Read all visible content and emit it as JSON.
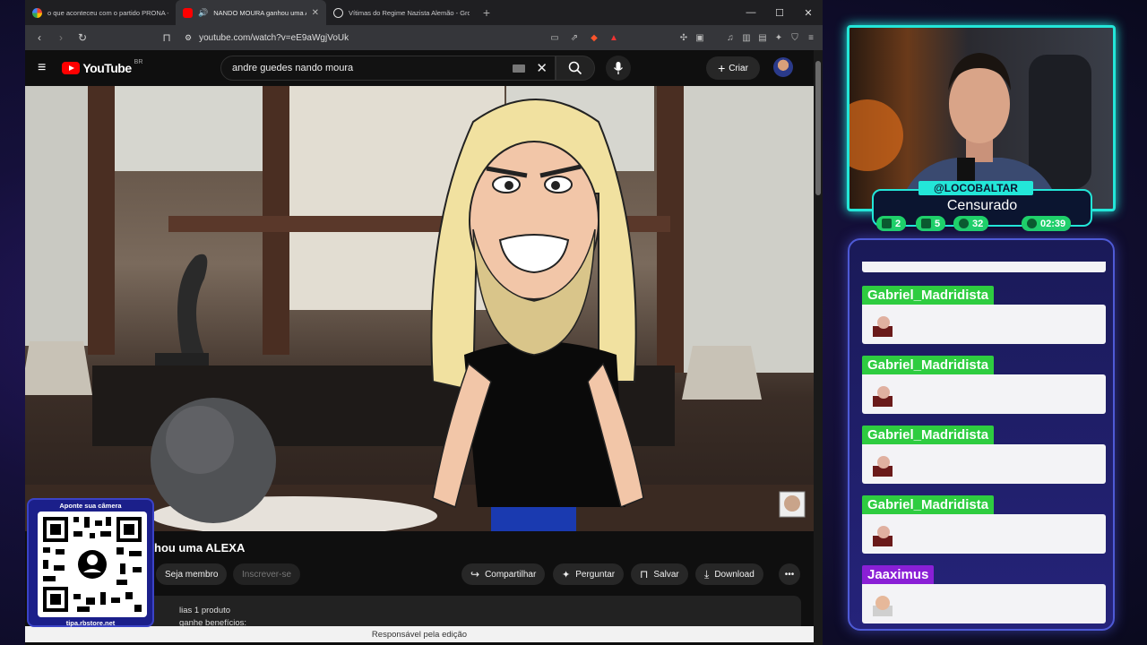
{
  "browser": {
    "tabs": [
      {
        "title": "o que aconteceu com o partido PRONA - Pe",
        "favicon_color": "#ffffff",
        "active": false
      },
      {
        "title": "NANDO MOURA ganhou uma ALEXA",
        "favicon_color": "#ff0000",
        "active": true
      },
      {
        "title": "Vítimas do Regime Nazista Alemão - Grok",
        "favicon_color": "#dddddd",
        "active": false
      }
    ],
    "url": "youtube.com/watch?v=eE9aWgjVoUk"
  },
  "youtube": {
    "logo_text": "YouTube",
    "country_code": "BR",
    "search_query": "andre guedes nando moura",
    "create_label": "Criar",
    "video_title": "hou uma ALEXA",
    "actions": {
      "member": "Seja membro",
      "subscribe": "Inscrever-se",
      "share": "Compartilhar",
      "ask": "Perguntar",
      "save": "Salvar",
      "download": "Download"
    },
    "description_line1": "lias  1 produto",
    "description_line2": "ganhe benefícios:"
  },
  "status_bar": "Responsável pela edição",
  "qr": {
    "top_label": "Aponte sua câmera",
    "bottom_label": "tipa.rbstore.net"
  },
  "stream": {
    "handle": "@LOCOBALTAR",
    "status": "Censurado",
    "stats": [
      {
        "icon": "chat-icon",
        "value": "2"
      },
      {
        "icon": "youtube-icon",
        "value": "5"
      },
      {
        "icon": "viewers-icon",
        "value": "32"
      },
      {
        "icon": "clock-icon",
        "value": "02:39"
      }
    ],
    "accent_color": "#23e6d8"
  },
  "chat": {
    "messages": [
      {
        "user": "Gabriel_Madridista",
        "color": "#2ecc40"
      },
      {
        "user": "Gabriel_Madridista",
        "color": "#2ecc40"
      },
      {
        "user": "Gabriel_Madridista",
        "color": "#2ecc40"
      },
      {
        "user": "Gabriel_Madridista",
        "color": "#2ecc40"
      },
      {
        "user": "Jaaximus",
        "color": "#8a1fd6"
      }
    ]
  }
}
